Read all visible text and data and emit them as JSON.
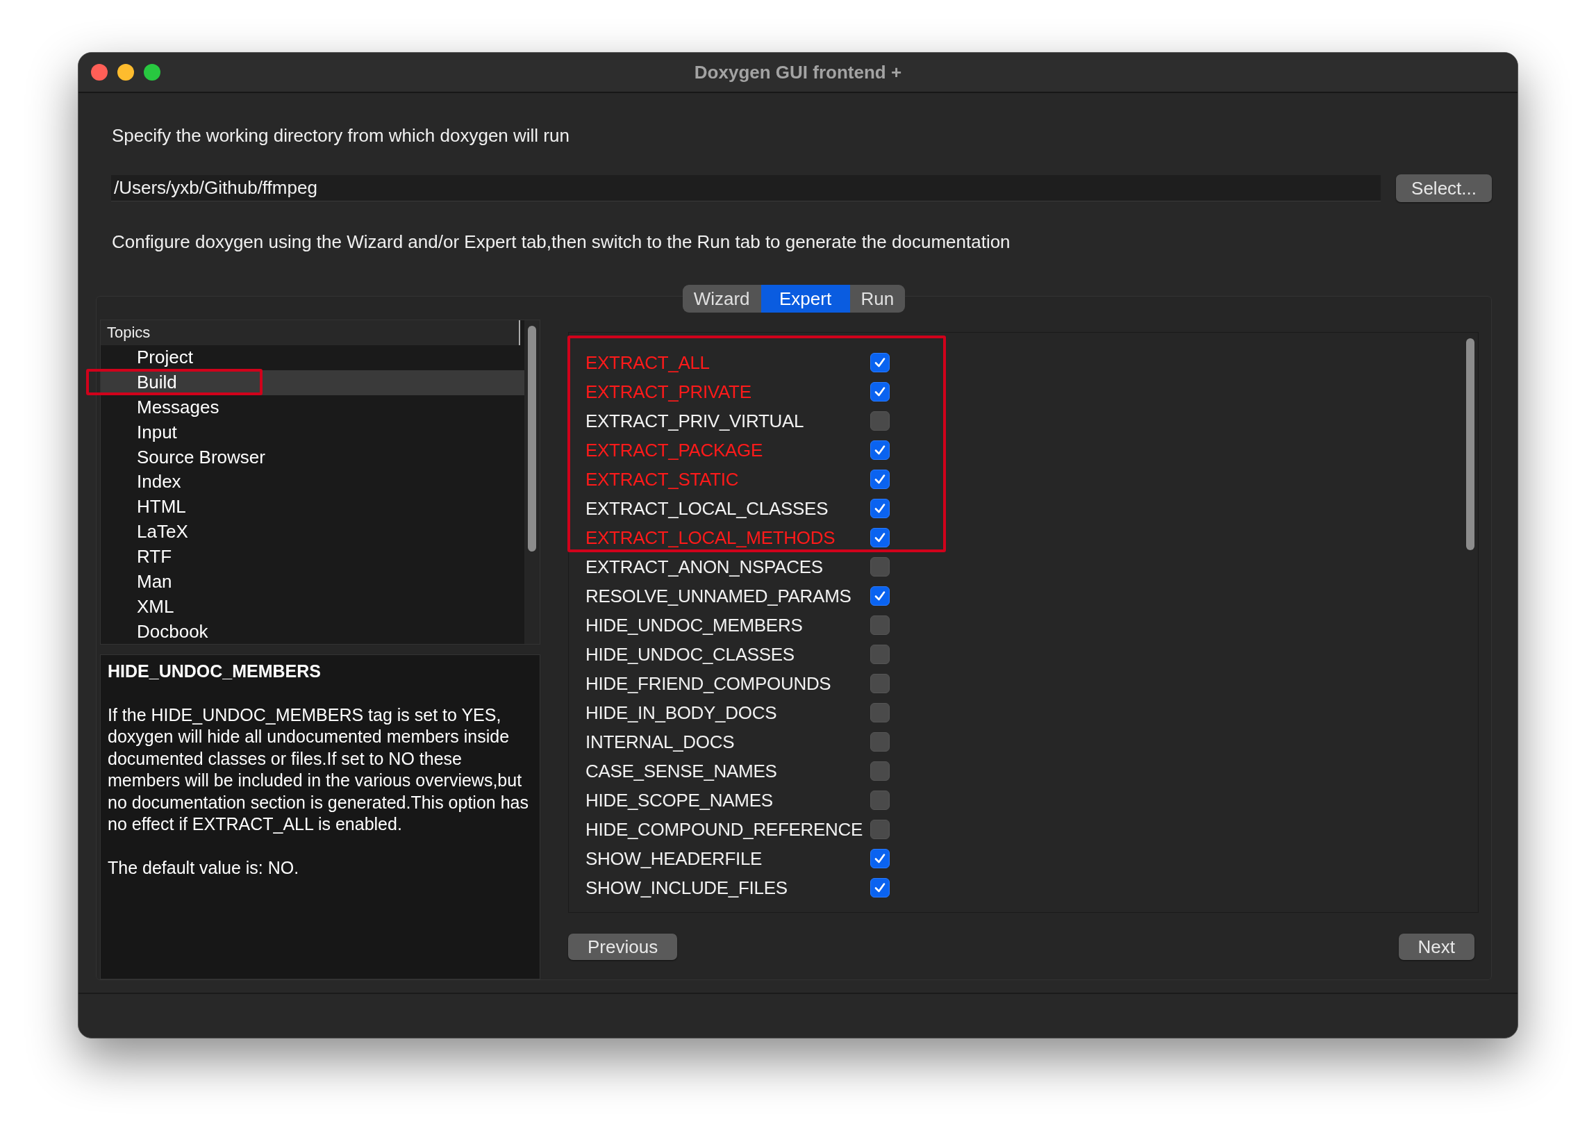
{
  "window": {
    "title": "Doxygen GUI frontend +"
  },
  "working_dir": {
    "label": "Specify the working directory from which doxygen will run",
    "value": "/Users/yxb/Github/ffmpeg",
    "button": "Select..."
  },
  "hint": "Configure doxygen using the Wizard and/or Expert tab,then switch to the Run tab to generate the documentation",
  "tabs": [
    {
      "label": "Wizard",
      "selected": false
    },
    {
      "label": "Expert",
      "selected": true
    },
    {
      "label": "Run",
      "selected": false
    }
  ],
  "topics": {
    "header": "Topics",
    "items": [
      {
        "label": "Project",
        "selected": false
      },
      {
        "label": "Build",
        "selected": true
      },
      {
        "label": "Messages",
        "selected": false
      },
      {
        "label": "Input",
        "selected": false
      },
      {
        "label": "Source Browser",
        "selected": false
      },
      {
        "label": "Index",
        "selected": false
      },
      {
        "label": "HTML",
        "selected": false
      },
      {
        "label": "LaTeX",
        "selected": false
      },
      {
        "label": "RTF",
        "selected": false
      },
      {
        "label": "Man",
        "selected": false
      },
      {
        "label": "XML",
        "selected": false
      },
      {
        "label": "Docbook",
        "selected": false
      }
    ]
  },
  "description": {
    "title": "HIDE_UNDOC_MEMBERS",
    "body": "If the HIDE_UNDOC_MEMBERS tag is set to YES, doxygen will hide all undocumented members inside documented classes or files.If set to NO these members will be included in the various overviews,but no documentation section is generated.This option has no effect if EXTRACT_ALL is enabled.",
    "default": "The default value is: NO."
  },
  "options": [
    {
      "name": "EXTRACT_ALL",
      "changed": true,
      "checked": true
    },
    {
      "name": "EXTRACT_PRIVATE",
      "changed": true,
      "checked": true
    },
    {
      "name": "EXTRACT_PRIV_VIRTUAL",
      "changed": false,
      "checked": false
    },
    {
      "name": "EXTRACT_PACKAGE",
      "changed": true,
      "checked": true
    },
    {
      "name": "EXTRACT_STATIC",
      "changed": true,
      "checked": true
    },
    {
      "name": "EXTRACT_LOCAL_CLASSES",
      "changed": false,
      "checked": true
    },
    {
      "name": "EXTRACT_LOCAL_METHODS",
      "changed": true,
      "checked": true
    },
    {
      "name": "EXTRACT_ANON_NSPACES",
      "changed": false,
      "checked": false
    },
    {
      "name": "RESOLVE_UNNAMED_PARAMS",
      "changed": false,
      "checked": true
    },
    {
      "name": "HIDE_UNDOC_MEMBERS",
      "changed": false,
      "checked": false
    },
    {
      "name": "HIDE_UNDOC_CLASSES",
      "changed": false,
      "checked": false
    },
    {
      "name": "HIDE_FRIEND_COMPOUNDS",
      "changed": false,
      "checked": false
    },
    {
      "name": "HIDE_IN_BODY_DOCS",
      "changed": false,
      "checked": false
    },
    {
      "name": "INTERNAL_DOCS",
      "changed": false,
      "checked": false
    },
    {
      "name": "CASE_SENSE_NAMES",
      "changed": false,
      "checked": false
    },
    {
      "name": "HIDE_SCOPE_NAMES",
      "changed": false,
      "checked": false
    },
    {
      "name": "HIDE_COMPOUND_REFERENCE",
      "changed": false,
      "checked": false
    },
    {
      "name": "SHOW_HEADERFILE",
      "changed": false,
      "checked": true
    },
    {
      "name": "SHOW_INCLUDE_FILES",
      "changed": false,
      "checked": true
    }
  ],
  "nav": {
    "previous": "Previous",
    "next": "Next"
  }
}
